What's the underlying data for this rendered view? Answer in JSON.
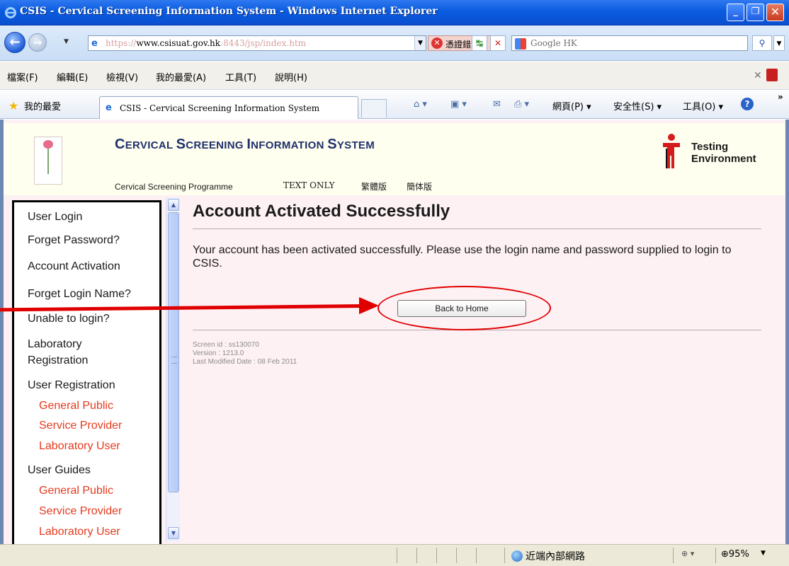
{
  "window": {
    "title": "CSIS - Cervical Screening Information System - Windows Internet Explorer"
  },
  "addressbar": {
    "url_scheme_host": "https://",
    "url_domain": "www.csisuat.gov.hk",
    "url_rest": ":8443/jsp/index.htm",
    "cert_error": "憑證錯誤",
    "search_placeholder": "Google HK"
  },
  "menubar": {
    "items": [
      "檔案(F)",
      "編輯(E)",
      "檢視(V)",
      "我的最愛(A)",
      "工具(T)",
      "說明(H)"
    ]
  },
  "favbar": {
    "favorites_label": "我的最愛",
    "tab_title": "CSIS - Cervical Screening Information System",
    "page_menu": "網頁(P) ▾",
    "safety_menu": "安全性(S) ▾",
    "tools_menu": "工具(O) ▾"
  },
  "site": {
    "title_parts": [
      "C",
      "ERVICAL ",
      "S",
      "CREENING ",
      "I",
      "NFORMATION ",
      "S",
      "YSTEM"
    ],
    "testing_line1": "Testing",
    "testing_line2": "Environment",
    "programme_link": "Cervical Screening Programme",
    "text_only": "TEXT ONLY",
    "trad_chinese": "繁體版",
    "simp_chinese": "簡体版"
  },
  "sidebar": {
    "items": [
      {
        "label": "User Login"
      },
      {
        "label": "Forget Password?"
      },
      {
        "label": "Account Activation"
      },
      {
        "label": "Forget Login Name?"
      },
      {
        "label": "Unable to login?"
      },
      {
        "label": "Laboratory"
      },
      {
        "label": "Registration"
      },
      {
        "label": "User Registration"
      },
      {
        "label": "General Public"
      },
      {
        "label": "Service Provider"
      },
      {
        "label": "Laboratory User"
      },
      {
        "label": "User Guides"
      },
      {
        "label": "General Public"
      },
      {
        "label": "Service Provider"
      },
      {
        "label": "Laboratory User"
      }
    ]
  },
  "main": {
    "heading": "Account Activated Successfully",
    "message": "Your account has been activated successfully. Please use the login name and password supplied to login to CSIS.",
    "back_button": "Back to Home",
    "screen_id": "Screen id : ss130070",
    "version": "Version : 1213.0",
    "last_modified": "Last Modified Date : 08 Feb 2011"
  },
  "statusbar": {
    "zone": "近端內部網路",
    "zoom": "95%"
  },
  "colors": {
    "annotation": "#e00000",
    "submenu_link": "#e53a1e",
    "content_bg": "#fef1f4",
    "header_bg": "#ffffef",
    "title_navy": "#1f2f6c"
  }
}
